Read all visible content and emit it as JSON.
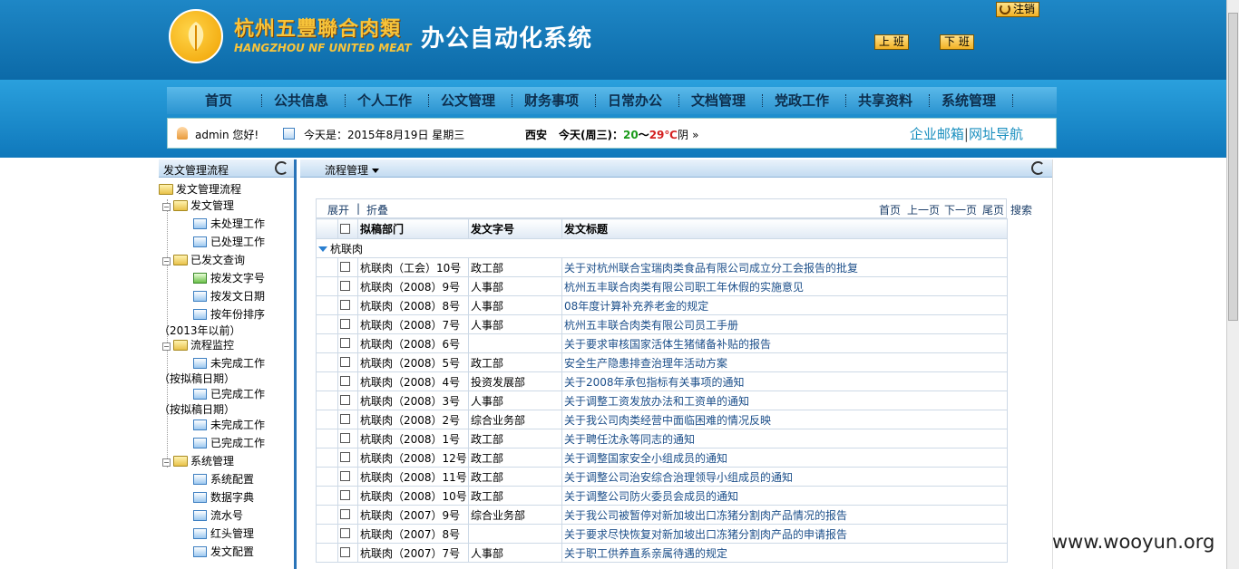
{
  "header": {
    "logo_cn": "杭州五豐聯合肉類",
    "logo_en": "HANGZHOU NF UNITED MEAT",
    "system_title": "办公自动化系统",
    "logout": "注销",
    "checkin": "上 班",
    "checkout": "下 班"
  },
  "nav": {
    "items": [
      {
        "label": "首页"
      },
      {
        "label": "公共信息"
      },
      {
        "label": "个人工作"
      },
      {
        "label": "公文管理"
      },
      {
        "label": "财务事项"
      },
      {
        "label": "日常办公"
      },
      {
        "label": "文档管理"
      },
      {
        "label": "党政工作"
      },
      {
        "label": "共享资料"
      },
      {
        "label": "系统管理"
      }
    ]
  },
  "infobar": {
    "greeting": "admin 您好!",
    "date": "今天是：2015年8月19日 星期三",
    "city": "西安",
    "weather_prefix": "今天(周三)：",
    "temp_low": "20",
    "temp_sep": "～",
    "temp_high": "29℃",
    "weather": "阴",
    "mail_link": "企业邮箱",
    "link_sep": "|",
    "nav_link": "网址导航"
  },
  "sidebar": {
    "title": "发文管理流程",
    "root": "发文管理流程",
    "groups": [
      {
        "label": "发文管理",
        "items": [
          "未处理工作",
          "已处理工作"
        ]
      },
      {
        "label": "已发文查询",
        "items": [
          "按发文字号",
          "按发文日期",
          "按年份排序",
          "（2013年以前）"
        ]
      },
      {
        "label": "流程监控",
        "items": [
          "未完成工作",
          "（按拟稿日期）",
          "已完成工作",
          "（按拟稿日期）",
          "未完成工作",
          "已完成工作"
        ]
      },
      {
        "label": "系统管理",
        "items": [
          "系统配置",
          "数据字典",
          "流水号",
          "红头管理",
          "发文配置"
        ]
      }
    ]
  },
  "main": {
    "title": "流程管理",
    "toolbar": {
      "expand": "展开",
      "sep": "|",
      "collapse": "折叠",
      "first": "首页",
      "prev": "上一页",
      "next": "下一页",
      "last": "尾页",
      "search": "搜索"
    },
    "columns": [
      "拟稿部门",
      "发文字号",
      "发文标题"
    ],
    "group": "杭联肉",
    "rows": [
      {
        "dept": "杭联肉（工会）10号",
        "code": "政工部",
        "title": "关于对杭州联合宝瑞肉类食品有限公司成立分工会报告的批复"
      },
      {
        "dept": "杭联肉（2008）9号",
        "code": "人事部",
        "title": "杭州五丰联合肉类有限公司职工年休假的实施意见"
      },
      {
        "dept": "杭联肉（2008）8号",
        "code": "人事部",
        "title": "08年度计算补充养老金的规定"
      },
      {
        "dept": "杭联肉（2008）7号",
        "code": "人事部",
        "title": "杭州五丰联合肉类有限公司员工手册"
      },
      {
        "dept": "杭联肉（2008）6号",
        "code": "",
        "title": "关于要求审核国家活体生猪储备补贴的报告"
      },
      {
        "dept": "杭联肉（2008）5号",
        "code": "政工部",
        "title": "安全生产隐患排查治理年活动方案"
      },
      {
        "dept": "杭联肉（2008）4号",
        "code": "投资发展部",
        "title": "关于2008年承包指标有关事项的通知"
      },
      {
        "dept": "杭联肉（2008）3号",
        "code": "人事部",
        "title": "关于调整工资发放办法和工资单的通知"
      },
      {
        "dept": "杭联肉（2008）2号",
        "code": "综合业务部",
        "title": "关于我公司肉类经营中面临困难的情况反映"
      },
      {
        "dept": "杭联肉（2008）1号",
        "code": "政工部",
        "title": "关于聘任沈永等同志的通知"
      },
      {
        "dept": "杭联肉（2008）12号",
        "code": "政工部",
        "title": "关于调整国家安全小组成员的通知"
      },
      {
        "dept": "杭联肉（2008）11号",
        "code": "政工部",
        "title": "关于调整公司治安综合治理领导小组成员的通知"
      },
      {
        "dept": "杭联肉（2008）10号",
        "code": "政工部",
        "title": "关于调整公司防火委员会成员的通知"
      },
      {
        "dept": "杭联肉（2007）9号",
        "code": "综合业务部",
        "title": "关于我公司被暂停对新加坡出口冻猪分割肉产品情况的报告"
      },
      {
        "dept": "杭联肉（2007）8号",
        "code": "",
        "title": "关于要求尽快恢复对新加坡出口冻猪分割肉产品的申请报告"
      },
      {
        "dept": "杭联肉（2007）7号",
        "code": "人事部",
        "title": "关于职工供养直系亲属待遇的规定"
      }
    ]
  },
  "watermark": "www.wooyun.org"
}
